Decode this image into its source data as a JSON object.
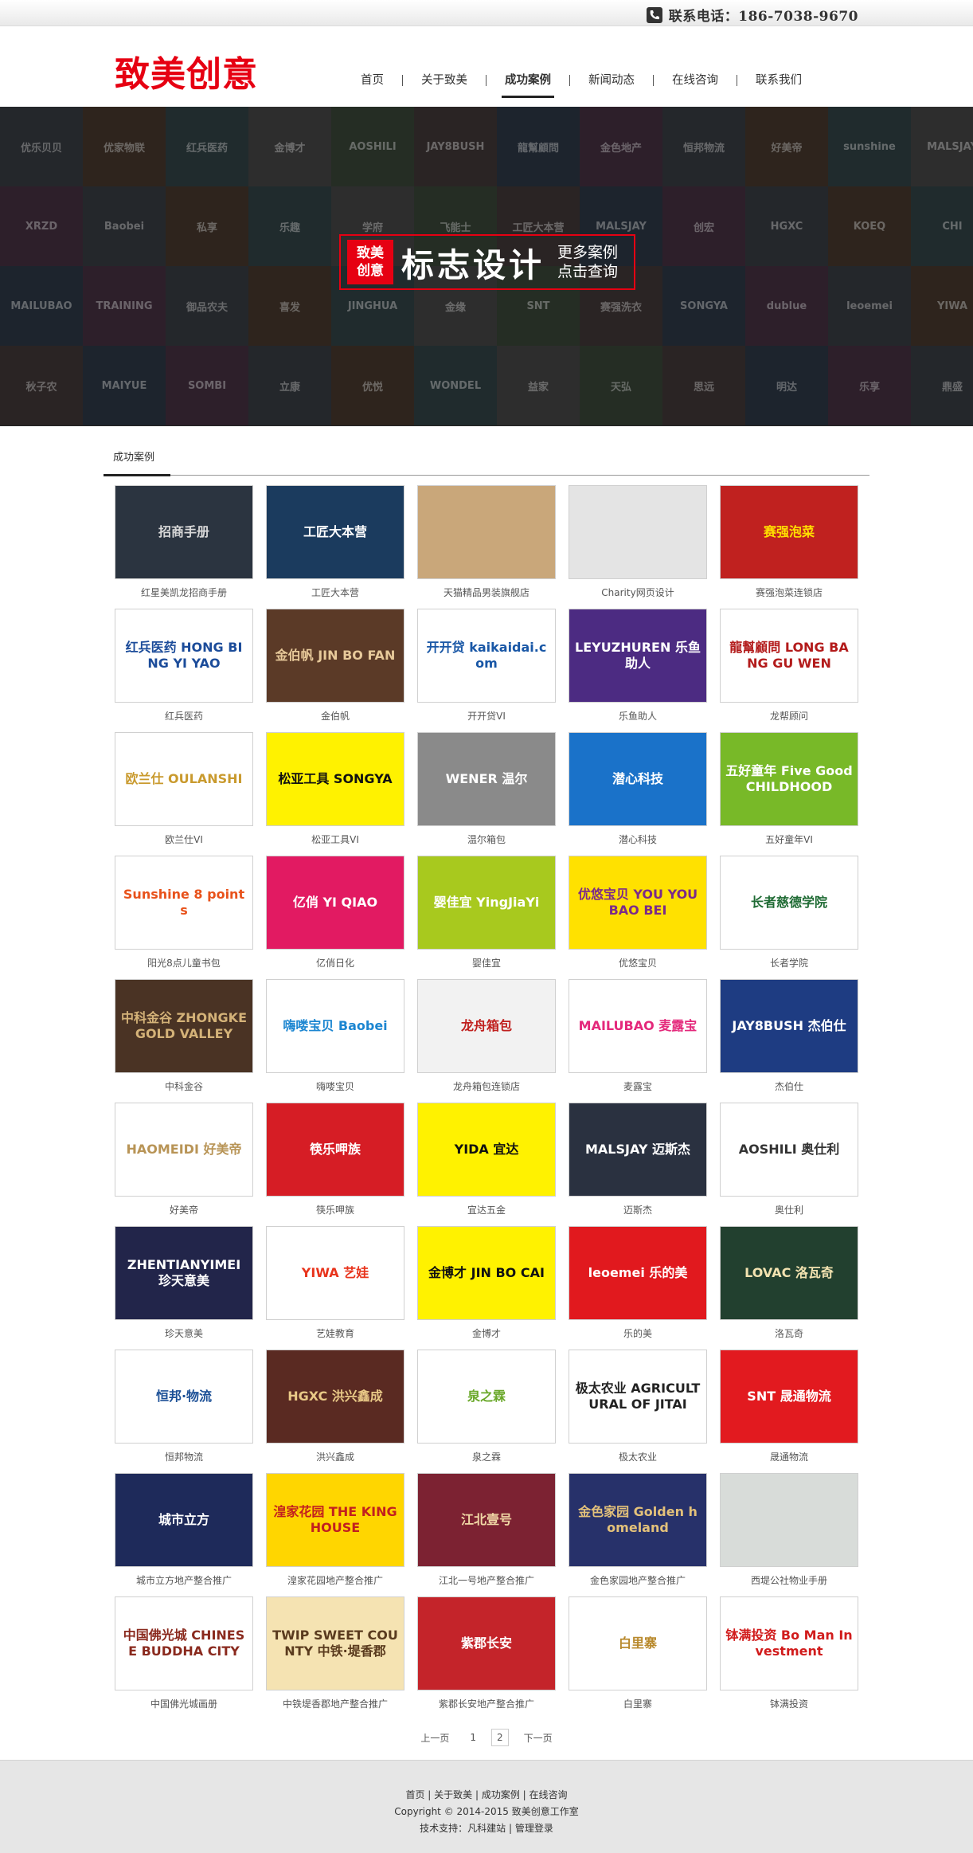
{
  "topbar": {
    "phone": "联系电话：186-7038-9670"
  },
  "header": {
    "logo": "致美创意",
    "nav": [
      "首页",
      "关于致美",
      "成功案例",
      "新闻动态",
      "在线咨询",
      "联系我们"
    ],
    "active_index": 2
  },
  "banner": {
    "badge_line1": "致美",
    "badge_line2": "创意",
    "title": "标志设计",
    "sub_line1": "更多案例",
    "sub_line2": "点击查询",
    "tiles": [
      "优乐贝贝",
      "优家物联",
      "红兵医药",
      "金博才",
      "AOSHILI",
      "JAY8BUSH",
      "龍幫顧問",
      "金色地产",
      "恒邦物流",
      "好美帝",
      "sunshine",
      "MALSJAY",
      "XRZD",
      "Baobei",
      "私享",
      "乐趣",
      "学府",
      "飞能士",
      "工匠大本营",
      "MALSJAY",
      "创宏",
      "HGXC",
      "KOEQ",
      "CHI",
      "MAILUBAO",
      "TRAINING",
      "御品农夫",
      "喜发",
      "JINGHUA",
      "金缘",
      "SNT",
      "赛强洗衣",
      "SONGYA",
      "dublue",
      "leoemei",
      "YIWA",
      "秋子农",
      "MAIYUE",
      "SOMBI",
      "立康",
      "优悦",
      "WONDEL",
      "益家",
      "天弘",
      "思远",
      "明达",
      "乐享",
      "鼎盛"
    ]
  },
  "section": {
    "title": "成功案例"
  },
  "cases": [
    {
      "caption": "红星美凯龙招商手册",
      "text": "招商手册",
      "bg": "#2b3440",
      "fg": "#d8d8d8"
    },
    {
      "caption": "工匠大本营",
      "text": "工匠大本营",
      "bg": "#1b3b5e",
      "fg": "#ffffff"
    },
    {
      "caption": "天猫精品男装旗舰店",
      "text": "",
      "bg": "#c9a77a",
      "fg": "#333333"
    },
    {
      "caption": "Charity网页设计",
      "text": "",
      "bg": "#e4e4e4",
      "fg": "#555555"
    },
    {
      "caption": "赛强泡菜连锁店",
      "text": "赛强泡菜",
      "bg": "#c0211f",
      "fg": "#ffe000"
    },
    {
      "caption": "红兵医药",
      "text": "红兵医药 HONG BING YI YAO",
      "bg": "#ffffff",
      "fg": "#1c4c9a"
    },
    {
      "caption": "金伯帆",
      "text": "金伯帆 JIN BO FAN",
      "bg": "#5b3a27",
      "fg": "#e7c99a"
    },
    {
      "caption": "开开贷VI",
      "text": "开开贷 kaikaidai.com",
      "bg": "#ffffff",
      "fg": "#1957a6"
    },
    {
      "caption": "乐鱼助人",
      "text": "LEYUZHUREN 乐鱼助人",
      "bg": "#4c2b82",
      "fg": "#ffffff"
    },
    {
      "caption": "龙帮顾问",
      "text": "龍幫顧問 LONG BANG GU WEN",
      "bg": "#ffffff",
      "fg": "#b31b1b"
    },
    {
      "caption": "欧兰仕VI",
      "text": "欧兰仕 OULANSHI",
      "bg": "#ffffff",
      "fg": "#c99a2e"
    },
    {
      "caption": "松亚工具VI",
      "text": "松亚工具 SONGYA",
      "bg": "#fff200",
      "fg": "#111111"
    },
    {
      "caption": "温尔箱包",
      "text": "WENER 温尔",
      "bg": "#8a8a8a",
      "fg": "#ffffff"
    },
    {
      "caption": "潜心科技",
      "text": "潜心科技",
      "bg": "#1a72c9",
      "fg": "#ffffff"
    },
    {
      "caption": "五好童年VI",
      "text": "五好童年 Five Good CHILDHOOD",
      "bg": "#78b928",
      "fg": "#ffffff"
    },
    {
      "caption": "阳光8点儿童书包",
      "text": "Sunshine 8 points",
      "bg": "#ffffff",
      "fg": "#e8521b"
    },
    {
      "caption": "亿俏日化",
      "text": "亿俏 YI QIAO",
      "bg": "#e21a62",
      "fg": "#ffffff"
    },
    {
      "caption": "婴佳宜",
      "text": "婴佳宜 YingJiaYi",
      "bg": "#a8c91e",
      "fg": "#ffffff"
    },
    {
      "caption": "优悠宝贝",
      "text": "优悠宝贝 YOU YOU BAO BEI",
      "bg": "#ffe100",
      "fg": "#7b2a8a"
    },
    {
      "caption": "长者学院",
      "text": "长者慈德学院",
      "bg": "#ffffff",
      "fg": "#1f6b34"
    },
    {
      "caption": "中科金谷",
      "text": "中科金谷 ZHONGKE GOLD VALLEY",
      "bg": "#4a3324",
      "fg": "#d4b278"
    },
    {
      "caption": "嗨喽宝贝",
      "text": "嗨喽宝贝 Baobei",
      "bg": "#ffffff",
      "fg": "#1c86d1"
    },
    {
      "caption": "龙舟箱包连锁店",
      "text": "龙舟箱包",
      "bg": "#f2f2f2",
      "fg": "#c0201e"
    },
    {
      "caption": "麦露宝",
      "text": "MAILUBAO 麦露宝",
      "bg": "#ffffff",
      "fg": "#e4287b"
    },
    {
      "caption": "杰伯仕",
      "text": "JAY8BUSH 杰伯仕",
      "bg": "#1e3c82",
      "fg": "#ffffff"
    },
    {
      "caption": "好美帝",
      "text": "HAOMEIDI 好美帝",
      "bg": "#ffffff",
      "fg": "#b89456"
    },
    {
      "caption": "筷乐呷族",
      "text": "筷乐呷族",
      "bg": "#d61d25",
      "fg": "#ffffff"
    },
    {
      "caption": "宜达五金",
      "text": "YIDA 宜达",
      "bg": "#fff200",
      "fg": "#111111"
    },
    {
      "caption": "迈斯杰",
      "text": "MALSJAY 迈斯杰",
      "bg": "#2a3140",
      "fg": "#ffffff"
    },
    {
      "caption": "奥仕利",
      "text": "AOSHILI 奥仕利",
      "bg": "#ffffff",
      "fg": "#333333"
    },
    {
      "caption": "珍天意美",
      "text": "ZHENTIANYIMEI 珍天意美",
      "bg": "#22254a",
      "fg": "#ffffff"
    },
    {
      "caption": "艺娃教育",
      "text": "YIWA 艺娃",
      "bg": "#ffffff",
      "fg": "#e8341c"
    },
    {
      "caption": "金博才",
      "text": "金博才 JIN BO CAI",
      "bg": "#fff200",
      "fg": "#111111"
    },
    {
      "caption": "乐的美",
      "text": "leoemei 乐的美",
      "bg": "#e1191e",
      "fg": "#ffffff"
    },
    {
      "caption": "洛瓦奇",
      "text": "LOVAC 洛瓦奇",
      "bg": "#22402f",
      "fg": "#f2e2b0"
    },
    {
      "caption": "恒邦物流",
      "text": "恒邦·物流",
      "bg": "#ffffff",
      "fg": "#1b4f96"
    },
    {
      "caption": "洪兴鑫成",
      "text": "HGXC 洪兴鑫成",
      "bg": "#5a2a22",
      "fg": "#e9c987"
    },
    {
      "caption": "泉之霖",
      "text": "泉之霖",
      "bg": "#ffffff",
      "fg": "#6aa82a"
    },
    {
      "caption": "极太农业",
      "text": "极太农业 AGRICULTURAL OF JITAI",
      "bg": "#ffffff",
      "fg": "#222222"
    },
    {
      "caption": "晟通物流",
      "text": "SNT 晟通物流",
      "bg": "#e21a1f",
      "fg": "#ffffff"
    },
    {
      "caption": "城市立方地产整合推广",
      "text": "城市立方",
      "bg": "#1e2a5a",
      "fg": "#ffffff"
    },
    {
      "caption": "湟家花园地产整合推广",
      "text": "湟家花园 THE KING HOUSE",
      "bg": "#ffd600",
      "fg": "#c21f1f"
    },
    {
      "caption": "江北一号地产整合推广",
      "text": "江北壹号",
      "bg": "#7c2232",
      "fg": "#f1d9a6"
    },
    {
      "caption": "金色家园地产整合推广",
      "text": "金色家园 Golden homeland",
      "bg": "#27316a",
      "fg": "#e3c17a"
    },
    {
      "caption": "西堤公社物业手册",
      "text": "",
      "bg": "#d8dcd9",
      "fg": "#3a7a3a"
    },
    {
      "caption": "中国佛光城画册",
      "text": "中国佛光城 CHINESE BUDDHA CITY",
      "bg": "#ffffff",
      "fg": "#8a2a1e"
    },
    {
      "caption": "中铁堤香郡地产整合推广",
      "text": "TWIP SWEET COUNTY 中铁·堤香郡",
      "bg": "#f5e3b2",
      "fg": "#5a3b1e"
    },
    {
      "caption": "紫郡长安地产整合推广",
      "text": "紫郡长安",
      "bg": "#c4242a",
      "fg": "#ffffff"
    },
    {
      "caption": "白里寨",
      "text": "白里寨",
      "bg": "#ffffff",
      "fg": "#b8892c"
    },
    {
      "caption": "钵满投资",
      "text": "钵满投资 Bo Man Investment",
      "bg": "#ffffff",
      "fg": "#d11c1c"
    }
  ],
  "pager": [
    "上一页",
    "1",
    "2",
    "下一页"
  ],
  "footer": {
    "links": [
      "首页",
      "关于致美",
      "成功案例",
      "在线咨询"
    ],
    "copyright": "Copyright   ©   2014-2015   致美创意工作室",
    "tech_prefix": "技术支持：",
    "tech_link1": "凡科建站",
    "tech_sep": " | ",
    "tech_link2": "管理登录"
  },
  "colors": {
    "brand_red": "#e60012",
    "footer_bg": "#e6e6e6"
  }
}
